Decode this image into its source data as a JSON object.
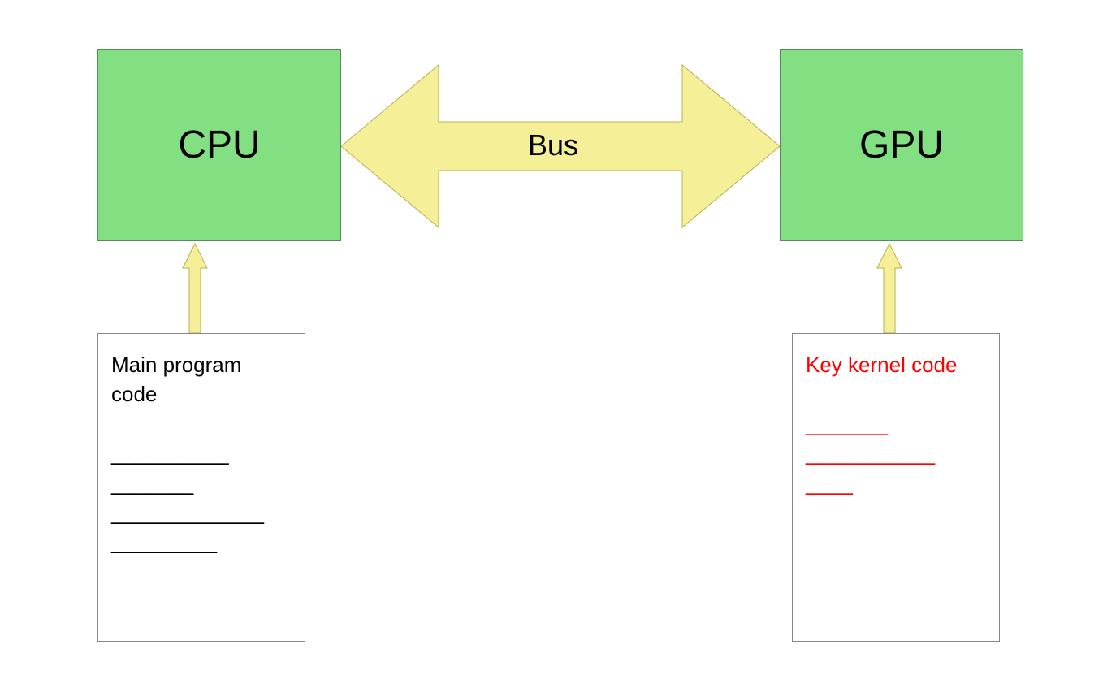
{
  "cpu": {
    "label": "CPU",
    "fill": "#82e082"
  },
  "gpu": {
    "label": "GPU",
    "fill": "#82e082"
  },
  "bus": {
    "label": "Bus",
    "fill": "#f5f098"
  },
  "mainProgram": {
    "title": "Main program code",
    "lines": [
      "__________",
      "_______",
      "_____________",
      "_________"
    ]
  },
  "kernel": {
    "title": "Key kernel code",
    "lines": [
      "_______",
      "___________",
      "____"
    ]
  }
}
